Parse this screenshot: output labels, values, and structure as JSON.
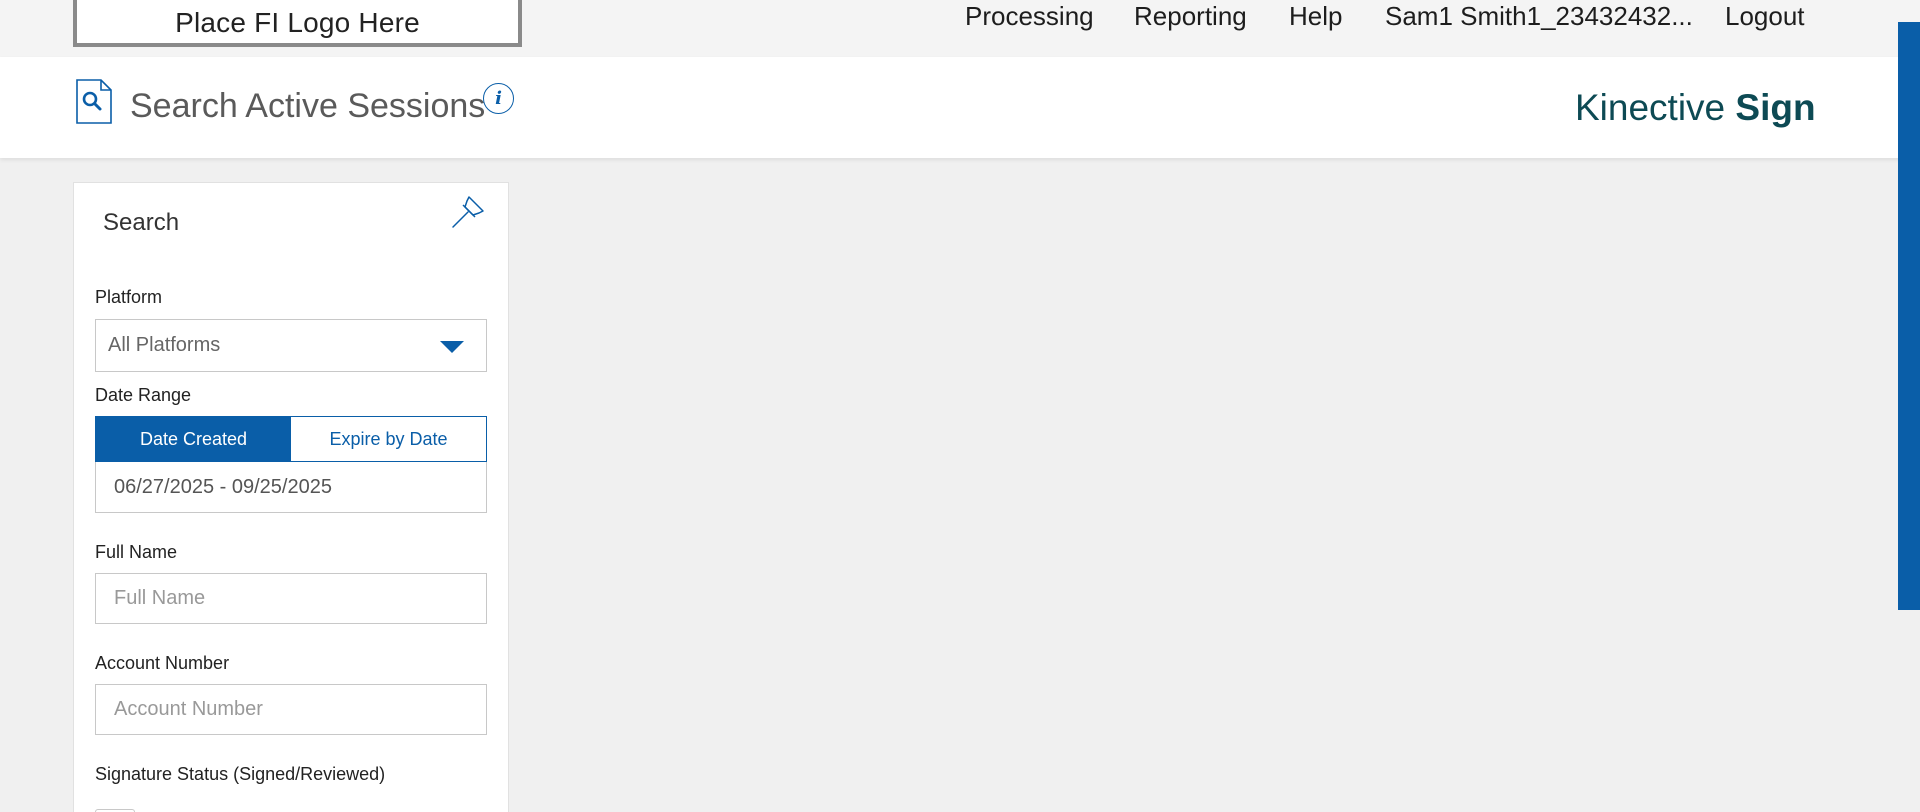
{
  "topbar": {
    "logo_text": "Place FI Logo Here",
    "nav": {
      "processing": "Processing",
      "reporting": "Reporting",
      "help": "Help",
      "user": "Sam1 Smith1_23432432...",
      "logout": "Logout"
    }
  },
  "header": {
    "title": "Search Active Sessions",
    "info_glyph": "i",
    "brand_part1": "Kinective ",
    "brand_part2": "Sign"
  },
  "search_panel": {
    "title": "Search",
    "platform": {
      "label": "Platform",
      "value": "All Platforms"
    },
    "date_range": {
      "label": "Date Range",
      "option_active": "Date Created",
      "option_inactive": "Expire by Date",
      "value": "06/27/2025 - 09/25/2025"
    },
    "full_name": {
      "label": "Full Name",
      "placeholder": "Full Name"
    },
    "account_number": {
      "label": "Account Number",
      "placeholder": "Account Number"
    },
    "signature_status": {
      "label": "Signature Status (Signed/Reviewed)"
    }
  },
  "colors": {
    "accent": "#0a5ea8",
    "brand": "#0d4a54",
    "background": "#f0f0f0",
    "topbar": "#f4f4f4"
  },
  "icons": {
    "header": "document-search-icon",
    "info": "info-icon",
    "pin": "pin-icon",
    "dropdown": "caret-down-icon"
  }
}
